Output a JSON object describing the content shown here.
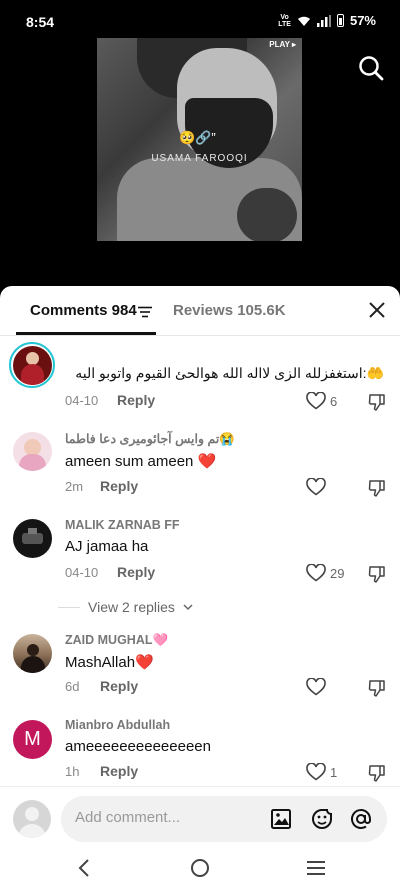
{
  "status": {
    "time": "8:54",
    "network": "Vo LTE",
    "battery": "57%"
  },
  "video": {
    "badge": "PLAY ▸",
    "emoji": "🥺🔗”",
    "caption": "USAMA FAROOQI"
  },
  "tabs": {
    "comments": "Comments 984",
    "reviews": "Reviews 105.6K"
  },
  "comments": [
    {
      "user": "",
      "text": "🤲:استغفزلله الزى لااله الله هوالحئ القيوم واتوبو اليه",
      "date": "04-10",
      "reply": "Reply",
      "likes": "6"
    },
    {
      "user": "تم وایس آجائومیری دعا فاطما😭",
      "text": "ameen sum ameen ❤️",
      "date": "2m",
      "reply": "Reply",
      "likes": ""
    },
    {
      "user": "MALIK ZARNAB FF",
      "text": "AJ jamaa ha",
      "date": "04-10",
      "reply": "Reply",
      "likes": "29"
    },
    {
      "user": "ZAID MUGHAL🩷",
      "text": "MashAllah❤️",
      "date": "6d",
      "reply": "Reply",
      "likes": ""
    },
    {
      "user": "Mianbro Abdullah",
      "text": "ameeeeeeeeeeeeeen",
      "date": "1h",
      "reply": "Reply",
      "likes": "1",
      "avatar_letter": "M"
    }
  ],
  "view_replies": "View 2 replies",
  "input": {
    "placeholder": "Add comment..."
  },
  "colors": {
    "accent_ring": "#25c6d3",
    "avatar_m": "#c2185b",
    "heart": "#e02020"
  }
}
